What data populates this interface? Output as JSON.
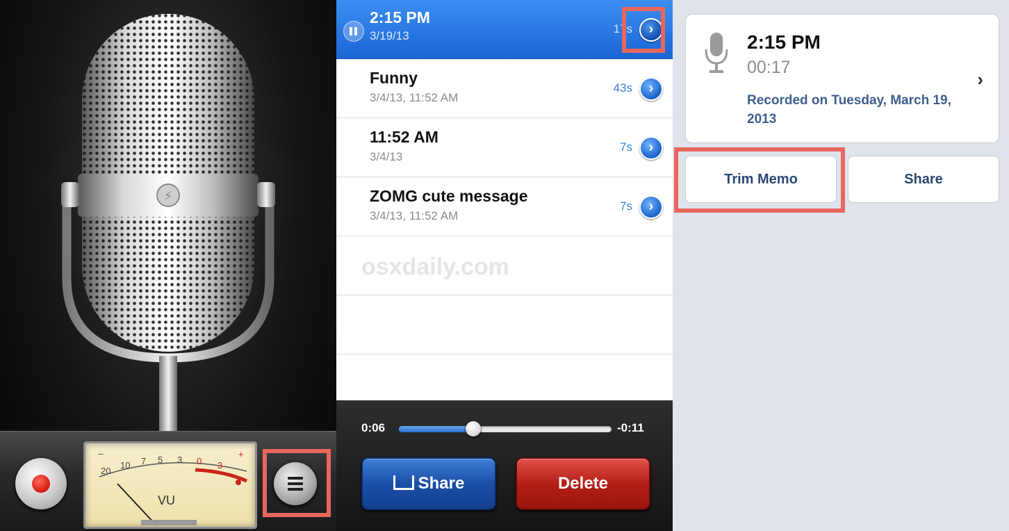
{
  "recorder": {
    "vu_scale": [
      "20",
      "10",
      "7",
      "5",
      "3",
      "0",
      "3",
      "+"
    ],
    "vu_minus": "−",
    "vu_label": "VU",
    "record_color": "#d41a10"
  },
  "memos": {
    "active": {
      "title": "2:15 PM",
      "date": "3/19/13",
      "duration": "17s"
    },
    "items": [
      {
        "title": "Funny",
        "date": "3/4/13, 11:52 AM",
        "duration": "43s"
      },
      {
        "title": "11:52 AM",
        "date": "3/4/13",
        "duration": "7s"
      },
      {
        "title": "ZOMG cute message",
        "date": "3/4/13, 11:52 AM",
        "duration": "7s"
      }
    ],
    "watermark": "osxdaily.com",
    "disclosure_glyph": "›"
  },
  "player": {
    "elapsed": "0:06",
    "remaining": "-0:11",
    "progress": 0.35,
    "share_label": "Share",
    "delete_label": "Delete"
  },
  "detail": {
    "title": "2:15 PM",
    "duration": "00:17",
    "recorded_on": "Recorded on Tuesday, March 19, 2013",
    "chevron": "›",
    "trim_label": "Trim Memo",
    "share_label": "Share"
  },
  "colors": {
    "highlight": "#e8675d",
    "accent_blue": "#1b66d6",
    "delete_red": "#b41f18"
  }
}
